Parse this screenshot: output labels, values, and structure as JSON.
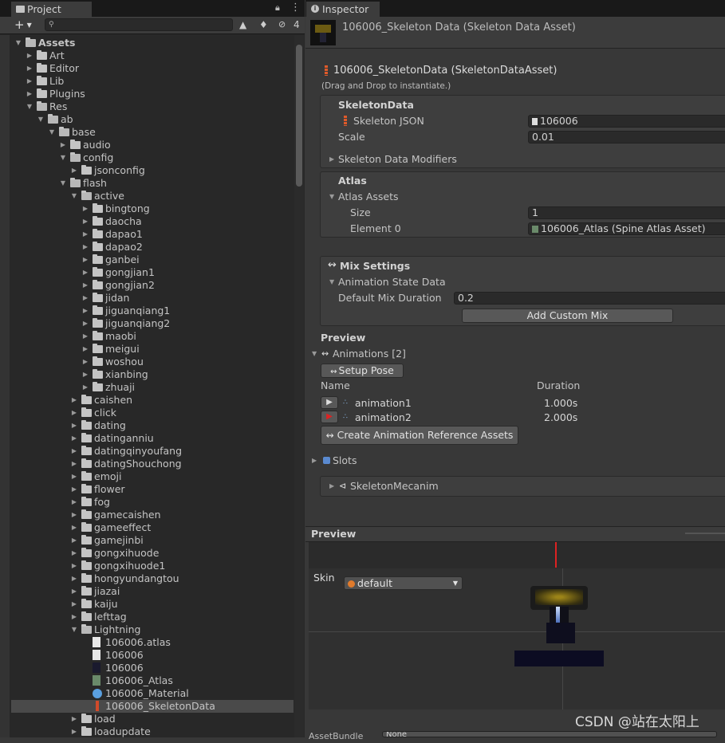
{
  "project": {
    "tab_label": "Project",
    "badge_count": "4",
    "tree": [
      {
        "depth": 0,
        "label": "Assets",
        "type": "folder",
        "open": true,
        "bold": true
      },
      {
        "depth": 1,
        "label": "Art",
        "type": "folder",
        "open": false
      },
      {
        "depth": 1,
        "label": "Editor",
        "type": "folder",
        "open": false
      },
      {
        "depth": 1,
        "label": "Lib",
        "type": "folder",
        "open": false
      },
      {
        "depth": 1,
        "label": "Plugins",
        "type": "folder",
        "open": false
      },
      {
        "depth": 1,
        "label": "Res",
        "type": "folder",
        "open": true
      },
      {
        "depth": 2,
        "label": "ab",
        "type": "folder",
        "open": true
      },
      {
        "depth": 3,
        "label": "base",
        "type": "folder",
        "open": true
      },
      {
        "depth": 4,
        "label": "audio",
        "type": "folder",
        "open": false
      },
      {
        "depth": 4,
        "label": "config",
        "type": "folder",
        "open": true
      },
      {
        "depth": 5,
        "label": "jsonconfig",
        "type": "folder",
        "open": false
      },
      {
        "depth": 4,
        "label": "flash",
        "type": "folder",
        "open": true
      },
      {
        "depth": 5,
        "label": "active",
        "type": "folder",
        "open": true
      },
      {
        "depth": 6,
        "label": "bingtong",
        "type": "folder",
        "open": false
      },
      {
        "depth": 6,
        "label": "daocha",
        "type": "folder",
        "open": false
      },
      {
        "depth": 6,
        "label": "dapao1",
        "type": "folder",
        "open": false
      },
      {
        "depth": 6,
        "label": "dapao2",
        "type": "folder",
        "open": false
      },
      {
        "depth": 6,
        "label": "ganbei",
        "type": "folder",
        "open": false
      },
      {
        "depth": 6,
        "label": "gongjian1",
        "type": "folder",
        "open": false
      },
      {
        "depth": 6,
        "label": "gongjian2",
        "type": "folder",
        "open": false
      },
      {
        "depth": 6,
        "label": "jidan",
        "type": "folder",
        "open": false
      },
      {
        "depth": 6,
        "label": "jiguanqiang1",
        "type": "folder",
        "open": false
      },
      {
        "depth": 6,
        "label": "jiguanqiang2",
        "type": "folder",
        "open": false
      },
      {
        "depth": 6,
        "label": "maobi",
        "type": "folder",
        "open": false
      },
      {
        "depth": 6,
        "label": "meigui",
        "type": "folder",
        "open": false
      },
      {
        "depth": 6,
        "label": "woshou",
        "type": "folder",
        "open": false
      },
      {
        "depth": 6,
        "label": "xianbing",
        "type": "folder",
        "open": false
      },
      {
        "depth": 6,
        "label": "zhuaji",
        "type": "folder",
        "open": false
      },
      {
        "depth": 5,
        "label": "caishen",
        "type": "folder",
        "open": false
      },
      {
        "depth": 5,
        "label": "click",
        "type": "folder",
        "open": false
      },
      {
        "depth": 5,
        "label": "dating",
        "type": "folder",
        "open": false
      },
      {
        "depth": 5,
        "label": "datinganniu",
        "type": "folder",
        "open": false
      },
      {
        "depth": 5,
        "label": "datingqinyoufang",
        "type": "folder",
        "open": false
      },
      {
        "depth": 5,
        "label": "datingShouchong",
        "type": "folder",
        "open": false
      },
      {
        "depth": 5,
        "label": "emoji",
        "type": "folder",
        "open": false
      },
      {
        "depth": 5,
        "label": "flower",
        "type": "folder",
        "open": false
      },
      {
        "depth": 5,
        "label": "fog",
        "type": "folder",
        "open": false
      },
      {
        "depth": 5,
        "label": "gamecaishen",
        "type": "folder",
        "open": false
      },
      {
        "depth": 5,
        "label": "gameeffect",
        "type": "folder",
        "open": false
      },
      {
        "depth": 5,
        "label": "gamejinbi",
        "type": "folder",
        "open": false
      },
      {
        "depth": 5,
        "label": "gongxihuode",
        "type": "folder",
        "open": false
      },
      {
        "depth": 5,
        "label": "gongxihuode1",
        "type": "folder",
        "open": false
      },
      {
        "depth": 5,
        "label": "hongyundangtou",
        "type": "folder",
        "open": false
      },
      {
        "depth": 5,
        "label": "jiazai",
        "type": "folder",
        "open": false
      },
      {
        "depth": 5,
        "label": "kaiju",
        "type": "folder",
        "open": false
      },
      {
        "depth": 5,
        "label": "lefttag",
        "type": "folder",
        "open": false
      },
      {
        "depth": 5,
        "label": "Lightning",
        "type": "folder",
        "open": true
      },
      {
        "depth": 6,
        "label": "106006.atlas",
        "type": "text-file"
      },
      {
        "depth": 6,
        "label": "106006",
        "type": "text-file"
      },
      {
        "depth": 6,
        "label": "106006",
        "type": "texture"
      },
      {
        "depth": 6,
        "label": "106006_Atlas",
        "type": "atlas-asset"
      },
      {
        "depth": 6,
        "label": "106006_Material",
        "type": "material"
      },
      {
        "depth": 6,
        "label": "106006_SkeletonData",
        "type": "skeleton-data",
        "selected": true
      },
      {
        "depth": 5,
        "label": "load",
        "type": "folder",
        "open": false
      },
      {
        "depth": 5,
        "label": "loadupdate",
        "type": "folder",
        "open": false
      }
    ]
  },
  "inspector": {
    "tab_label": "Inspector",
    "header_title": "106006_Skeleton Data (Skeleton Data Asset)",
    "asset_title": "106006_SkeletonData (SkeletonDataAsset)",
    "drag_hint": "(Drag and Drop to instantiate.)",
    "skeleton_data": {
      "section": "SkeletonData",
      "json_label": "Skeleton JSON",
      "json_value": "106006",
      "scale_label": "Scale",
      "scale_value": "0.01",
      "modifiers_label": "Skeleton Data Modifiers"
    },
    "atlas": {
      "section": "Atlas",
      "assets_label": "Atlas Assets",
      "size_label": "Size",
      "size_value": "1",
      "element_label": "Element 0",
      "element_value": "106006_Atlas (Spine Atlas Asset)"
    },
    "mix": {
      "section": "Mix Settings",
      "state_label": "Animation State Data",
      "duration_label": "Default Mix Duration",
      "duration_value": "0.2",
      "add_button": "Add Custom Mix"
    },
    "preview": {
      "section": "Preview",
      "animations_label": "Animations [2]",
      "setup_pose_button": "Setup Pose",
      "col_name": "Name",
      "col_duration": "Duration",
      "animations": [
        {
          "name": "animation1",
          "duration": "1.000s",
          "playing": false
        },
        {
          "name": "animation2",
          "duration": "2.000s",
          "playing": true
        }
      ],
      "create_button": "Create Animation Reference Assets",
      "slots_label": "Slots",
      "mecanim_label": "SkeletonMecanim"
    },
    "preview_panel": {
      "title": "Preview",
      "skin_label": "Skin",
      "skin_value": "default"
    },
    "bottom": {
      "asset_bundle_label": "AssetBundle",
      "asset_bundle_value": "None"
    },
    "watermark": "CSDN @站在太阳上"
  }
}
